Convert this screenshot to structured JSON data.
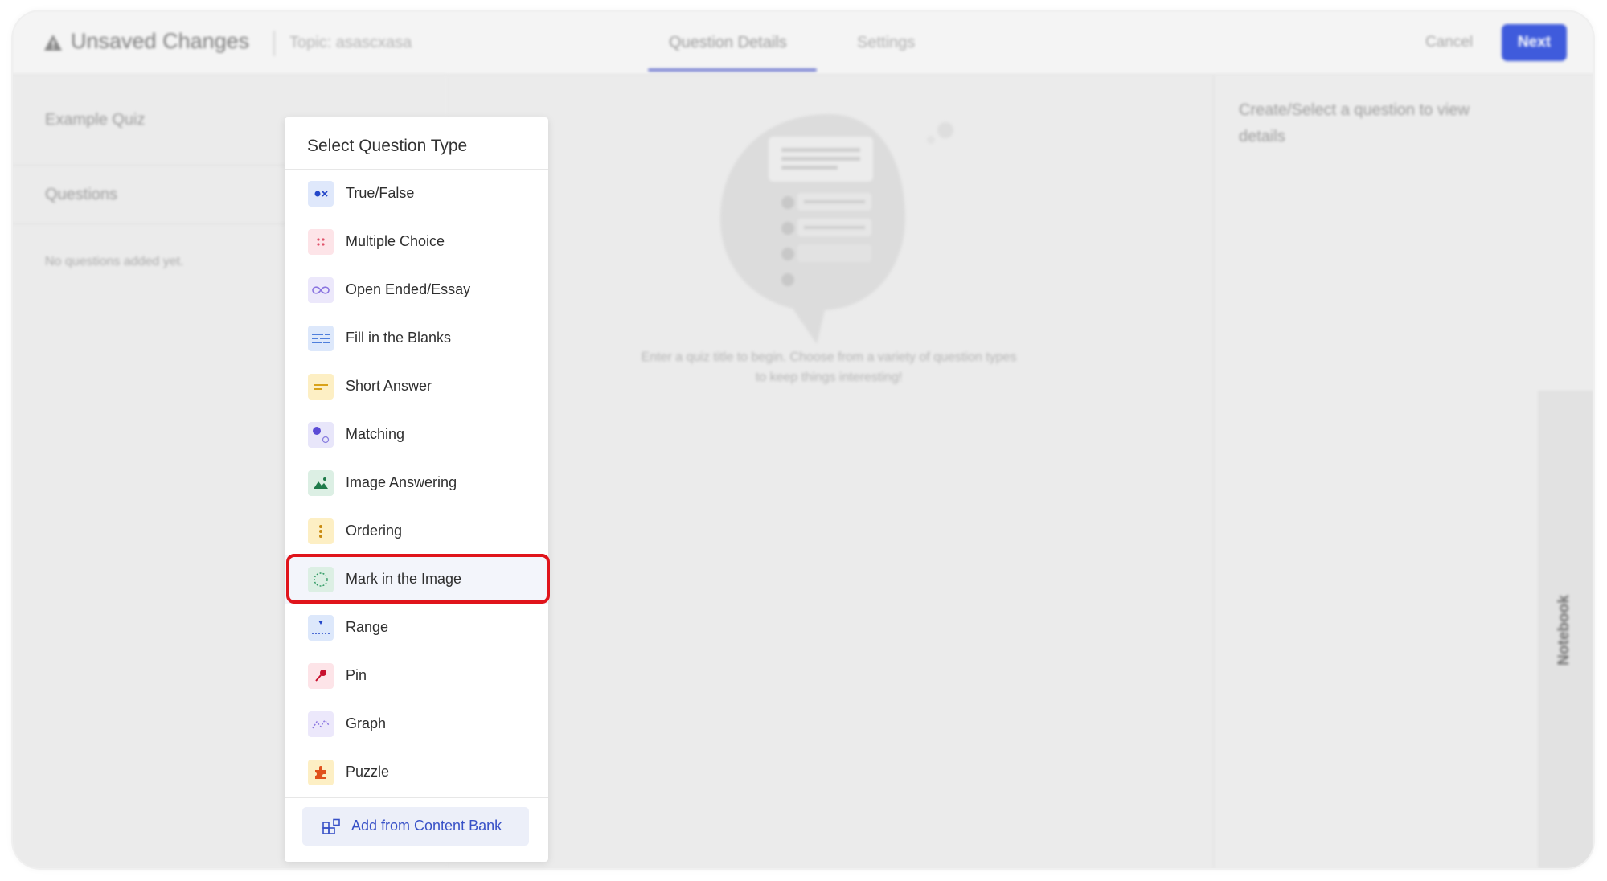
{
  "header": {
    "title": "Unsaved Changes",
    "topic": "Topic: asascxasa",
    "tabs": [
      {
        "label": "Question Details",
        "active": true
      },
      {
        "label": "Settings",
        "active": false
      }
    ],
    "cancel_label": "Cancel",
    "next_label": "Next"
  },
  "left_panel": {
    "quiz_name": "Example Quiz",
    "questions_heading": "Questions",
    "empty_text": "No questions added yet."
  },
  "center": {
    "hint_text": "Enter a quiz title to begin. Choose from a variety of question types to keep things interesting!"
  },
  "right_panel": {
    "details_text": "Create/Select a question to view details",
    "notebook_label": "Notebook"
  },
  "dropdown": {
    "title": "Select Question Type",
    "items": [
      {
        "label": "True/False",
        "icon": "true-false-icon"
      },
      {
        "label": "Multiple Choice",
        "icon": "multiple-choice-icon"
      },
      {
        "label": "Open Ended/Essay",
        "icon": "open-ended-icon"
      },
      {
        "label": "Fill in the Blanks",
        "icon": "fill-blanks-icon"
      },
      {
        "label": "Short Answer",
        "icon": "short-answer-icon"
      },
      {
        "label": "Matching",
        "icon": "matching-icon"
      },
      {
        "label": "Image Answering",
        "icon": "image-answering-icon"
      },
      {
        "label": "Ordering",
        "icon": "ordering-icon"
      },
      {
        "label": "Mark in the Image",
        "icon": "mark-image-icon",
        "highlighted": true
      },
      {
        "label": "Range",
        "icon": "range-icon"
      },
      {
        "label": "Pin",
        "icon": "pin-icon"
      },
      {
        "label": "Graph",
        "icon": "graph-icon"
      },
      {
        "label": "Puzzle",
        "icon": "puzzle-icon"
      }
    ],
    "footer_button": "Add from Content Bank"
  },
  "colors": {
    "accent": "#3f5bdc",
    "highlight_border": "#e0141b",
    "content_bank_text": "#3851c7"
  }
}
